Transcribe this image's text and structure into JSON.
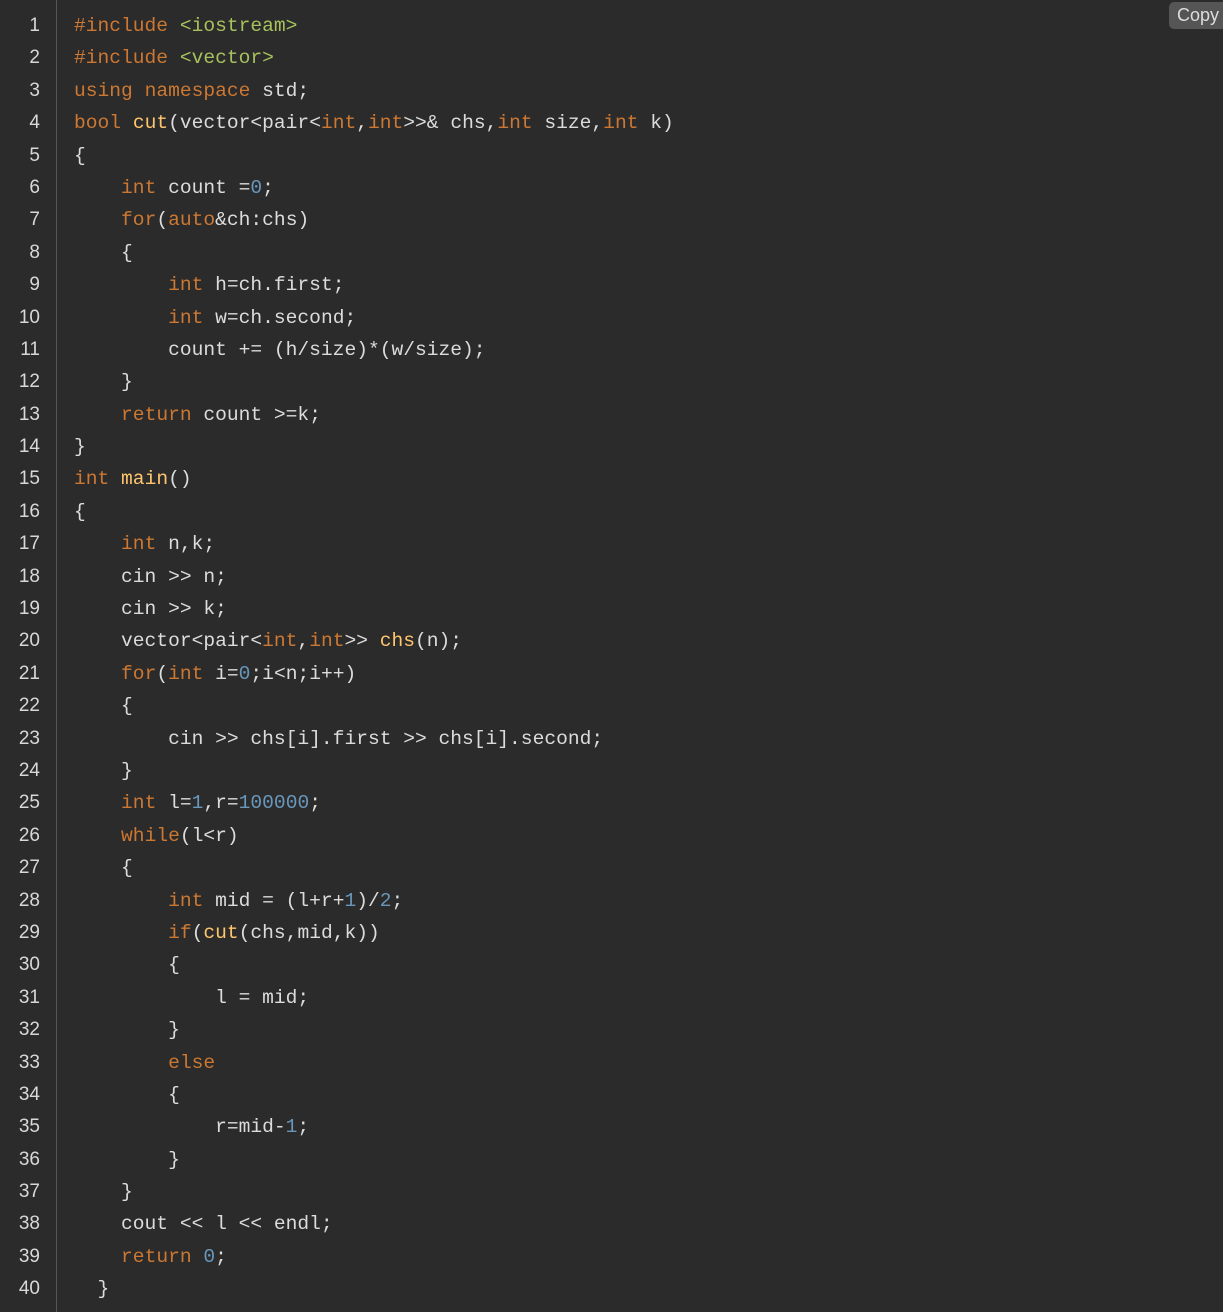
{
  "copy_button": {
    "label": "Copy"
  },
  "colors": {
    "background": "#2b2b2b",
    "keyword": "#cc7832",
    "function": "#ffc66d",
    "string": "#a5c25c",
    "number": "#6897bb",
    "text": "#dcdcdc",
    "line_number": "#d8d8d8"
  },
  "code": {
    "language": "cpp",
    "lines": [
      {
        "n": "1",
        "tokens": [
          [
            "pre",
            "#include"
          ],
          [
            "plain",
            " "
          ],
          [
            "str",
            "<iostream>"
          ]
        ]
      },
      {
        "n": "2",
        "tokens": [
          [
            "pre",
            "#include"
          ],
          [
            "plain",
            " "
          ],
          [
            "str",
            "<vector>"
          ]
        ]
      },
      {
        "n": "3",
        "tokens": [
          [
            "kw",
            "using"
          ],
          [
            "plain",
            " "
          ],
          [
            "kw",
            "namespace"
          ],
          [
            "plain",
            " std;"
          ]
        ]
      },
      {
        "n": "4",
        "tokens": [
          [
            "kw",
            "bool"
          ],
          [
            "plain",
            " "
          ],
          [
            "fn",
            "cut"
          ],
          [
            "plain",
            "(vector<pair<"
          ],
          [
            "kw",
            "int"
          ],
          [
            "plain",
            ","
          ],
          [
            "kw",
            "int"
          ],
          [
            "plain",
            ">>& chs,"
          ],
          [
            "kw",
            "int"
          ],
          [
            "plain",
            " size,"
          ],
          [
            "kw",
            "int"
          ],
          [
            "plain",
            " k)"
          ]
        ]
      },
      {
        "n": "5",
        "tokens": [
          [
            "plain",
            "{"
          ]
        ]
      },
      {
        "n": "6",
        "tokens": [
          [
            "plain",
            "    "
          ],
          [
            "kw",
            "int"
          ],
          [
            "plain",
            " count ="
          ],
          [
            "num",
            "0"
          ],
          [
            "plain",
            ";"
          ]
        ]
      },
      {
        "n": "7",
        "tokens": [
          [
            "plain",
            "    "
          ],
          [
            "kw",
            "for"
          ],
          [
            "plain",
            "("
          ],
          [
            "kw",
            "auto"
          ],
          [
            "plain",
            "&ch:chs)"
          ]
        ]
      },
      {
        "n": "8",
        "tokens": [
          [
            "plain",
            "    {"
          ]
        ]
      },
      {
        "n": "9",
        "tokens": [
          [
            "plain",
            "        "
          ],
          [
            "kw",
            "int"
          ],
          [
            "plain",
            " h=ch.first;"
          ]
        ]
      },
      {
        "n": "10",
        "tokens": [
          [
            "plain",
            "        "
          ],
          [
            "kw",
            "int"
          ],
          [
            "plain",
            " w=ch.second;"
          ]
        ]
      },
      {
        "n": "11",
        "tokens": [
          [
            "plain",
            "        count += (h/size)*(w/size);"
          ]
        ]
      },
      {
        "n": "12",
        "tokens": [
          [
            "plain",
            "    }"
          ]
        ]
      },
      {
        "n": "13",
        "tokens": [
          [
            "plain",
            "    "
          ],
          [
            "kw",
            "return"
          ],
          [
            "plain",
            " count >=k;"
          ]
        ]
      },
      {
        "n": "14",
        "tokens": [
          [
            "plain",
            "}"
          ]
        ]
      },
      {
        "n": "15",
        "tokens": [
          [
            "kw",
            "int"
          ],
          [
            "plain",
            " "
          ],
          [
            "fn",
            "main"
          ],
          [
            "plain",
            "()"
          ]
        ]
      },
      {
        "n": "16",
        "tokens": [
          [
            "plain",
            "{"
          ]
        ]
      },
      {
        "n": "17",
        "tokens": [
          [
            "plain",
            "    "
          ],
          [
            "kw",
            "int"
          ],
          [
            "plain",
            " n,k;"
          ]
        ]
      },
      {
        "n": "18",
        "tokens": [
          [
            "plain",
            "    cin >> n;"
          ]
        ]
      },
      {
        "n": "19",
        "tokens": [
          [
            "plain",
            "    cin >> k;"
          ]
        ]
      },
      {
        "n": "20",
        "tokens": [
          [
            "plain",
            "    vector<pair<"
          ],
          [
            "kw",
            "int"
          ],
          [
            "plain",
            ","
          ],
          [
            "kw",
            "int"
          ],
          [
            "plain",
            ">> "
          ],
          [
            "fn",
            "chs"
          ],
          [
            "plain",
            "(n);"
          ]
        ]
      },
      {
        "n": "21",
        "tokens": [
          [
            "plain",
            "    "
          ],
          [
            "kw",
            "for"
          ],
          [
            "plain",
            "("
          ],
          [
            "kw",
            "int"
          ],
          [
            "plain",
            " i="
          ],
          [
            "num",
            "0"
          ],
          [
            "plain",
            ";i<n;i++)"
          ]
        ]
      },
      {
        "n": "22",
        "tokens": [
          [
            "plain",
            "    {"
          ]
        ]
      },
      {
        "n": "23",
        "tokens": [
          [
            "plain",
            "        cin >> chs[i].first >> chs[i].second;"
          ]
        ]
      },
      {
        "n": "24",
        "tokens": [
          [
            "plain",
            "    }"
          ]
        ]
      },
      {
        "n": "25",
        "tokens": [
          [
            "plain",
            "    "
          ],
          [
            "kw",
            "int"
          ],
          [
            "plain",
            " l="
          ],
          [
            "num",
            "1"
          ],
          [
            "plain",
            ",r="
          ],
          [
            "num",
            "100000"
          ],
          [
            "plain",
            ";"
          ]
        ]
      },
      {
        "n": "26",
        "tokens": [
          [
            "plain",
            "    "
          ],
          [
            "kw",
            "while"
          ],
          [
            "plain",
            "(l<r)"
          ]
        ]
      },
      {
        "n": "27",
        "tokens": [
          [
            "plain",
            "    {"
          ]
        ]
      },
      {
        "n": "28",
        "tokens": [
          [
            "plain",
            "        "
          ],
          [
            "kw",
            "int"
          ],
          [
            "plain",
            " mid = (l+r+"
          ],
          [
            "num",
            "1"
          ],
          [
            "plain",
            ")/"
          ],
          [
            "num",
            "2"
          ],
          [
            "plain",
            ";"
          ]
        ]
      },
      {
        "n": "29",
        "tokens": [
          [
            "plain",
            "        "
          ],
          [
            "kw",
            "if"
          ],
          [
            "plain",
            "("
          ],
          [
            "fn",
            "cut"
          ],
          [
            "plain",
            "(chs,mid,k))"
          ]
        ]
      },
      {
        "n": "30",
        "tokens": [
          [
            "plain",
            "        {"
          ]
        ]
      },
      {
        "n": "31",
        "tokens": [
          [
            "plain",
            "            l = mid;"
          ]
        ]
      },
      {
        "n": "32",
        "tokens": [
          [
            "plain",
            "        }"
          ]
        ]
      },
      {
        "n": "33",
        "tokens": [
          [
            "plain",
            "        "
          ],
          [
            "kw",
            "else"
          ]
        ]
      },
      {
        "n": "34",
        "tokens": [
          [
            "plain",
            "        {"
          ]
        ]
      },
      {
        "n": "35",
        "tokens": [
          [
            "plain",
            "            r=mid-"
          ],
          [
            "num",
            "1"
          ],
          [
            "plain",
            ";"
          ]
        ]
      },
      {
        "n": "36",
        "tokens": [
          [
            "plain",
            "        }"
          ]
        ]
      },
      {
        "n": "37",
        "tokens": [
          [
            "plain",
            "    }"
          ]
        ]
      },
      {
        "n": "38",
        "tokens": [
          [
            "plain",
            "    cout << l << endl;"
          ]
        ]
      },
      {
        "n": "39",
        "tokens": [
          [
            "plain",
            "    "
          ],
          [
            "kw",
            "return"
          ],
          [
            "plain",
            " "
          ],
          [
            "num",
            "0"
          ],
          [
            "plain",
            ";"
          ]
        ]
      },
      {
        "n": "40",
        "tokens": [
          [
            "plain",
            "  }"
          ]
        ]
      }
    ]
  }
}
